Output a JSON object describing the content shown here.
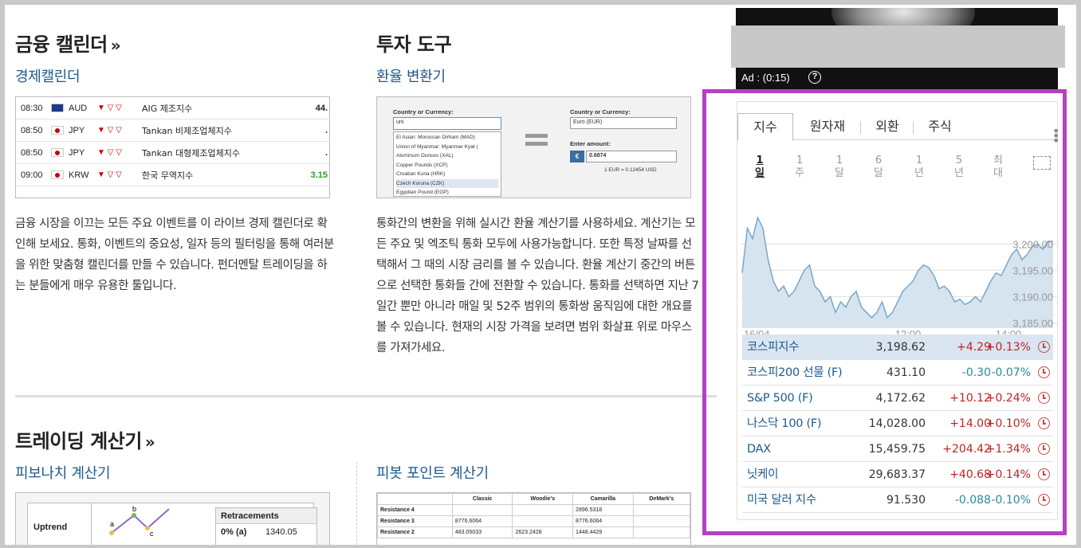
{
  "calendar": {
    "title": "금융 캘린더",
    "raquo": "»",
    "subtitle": "경제캘린더",
    "rows": [
      {
        "time": "08:30",
        "currency": "AUD",
        "event": "AIG 제조지수",
        "value": "44."
      },
      {
        "time": "08:50",
        "currency": "JPY",
        "event": "Tankan 비제조업체지수",
        "value": "."
      },
      {
        "time": "08:50",
        "currency": "JPY",
        "event": "Tankan 대형제조업체지수",
        "value": "."
      },
      {
        "time": "09:00",
        "currency": "KRW",
        "event": "한국 무역지수",
        "value": "3.15"
      }
    ],
    "description": "금융 시장을 이끄는 모든 주요 이벤트를 이 라이브 경제 캘린더로 확인해 보세요. 통화, 이벤트의 중요성, 일자 등의 필터링을 통해 여러분을 위한 맞춤형 캘린더를 만들 수 있습니다. 펀더멘탈 트레이딩을 하는 분들에게 매우 유용한 툴입니다."
  },
  "tools": {
    "title": "투자 도구",
    "subtitle": "환율 변환기",
    "converter": {
      "from_label": "Country or Currency:",
      "from_value": "uni",
      "options": [
        "El Asian: Moroccan Dirham (MAD)",
        "Union of Myanmar: Myanmar Kyat (",
        "Aluminum Ounces (XAL)",
        "Copper Pounds (XCP)",
        "Croatian Kuna (HRK)",
        "Czech Koruna (CZK)",
        "Egyptian Pound (EGP)"
      ],
      "to_label": "Country or Currency:",
      "to_value": "Euro (EUR)",
      "amount_label": "Enter amount:",
      "amount_value": "0.6874",
      "currency_symbol": "€",
      "rate": "1 EUR = 0.12454 USD"
    },
    "description": "통화간의 변환을 위해 실시간 환율 계산기를 사용하세요. 계산기는 모든 주요 및 엑조틱 통화 모두에 사용가능합니다. 또한 특정 날짜를 선택해서 그 때의 시장 금리를 볼 수 있습니다. 환율 계산기 중간의 버튼으로 선택한 통화들 간에 전환할 수 있습니다. 통화를 선택하면 지난 7일간 뿐만 아니라 매일 및 52주 범위의 통화쌍 움직임에 대한 개요를 볼 수 있습니다. 현재의 시장 가격을 보려면 범위 화살표 위로 마우스를 가져가세요."
  },
  "trading": {
    "title": "트레이딩 계산기",
    "fib_title": "피보나치 계산기",
    "pivot_title": "피봇 포인트 계산기",
    "fib": {
      "trend": "Uptrend",
      "retracements": "Retracements",
      "row_label": "0% (a)",
      "row_value": "1340.05",
      "points": [
        "a",
        "b",
        "c"
      ]
    },
    "pivot": {
      "headers": [
        "",
        "Classic",
        "Woodie's",
        "Camarilla",
        "DeMark's"
      ],
      "rows": [
        [
          "Resistance 4",
          "",
          "",
          "2896.5318",
          ""
        ],
        [
          "Resistance 3",
          "8776.6064",
          "",
          "8776.6064",
          ""
        ],
        [
          "Resistance 2",
          "483.05033",
          "2623.2428",
          "1448.4429",
          ""
        ]
      ]
    }
  },
  "ad": {
    "label": "Ad : (0:15)",
    "help": "?"
  },
  "widget": {
    "tabs": [
      "지수",
      "원자재",
      "외환",
      "주식"
    ],
    "active_tab": "지수",
    "ranges": [
      [
        "1",
        "일"
      ],
      [
        "1",
        "주"
      ],
      [
        "1",
        "달"
      ],
      [
        "6",
        "달"
      ],
      [
        "1",
        "년"
      ],
      [
        "5",
        "년"
      ],
      [
        "최",
        "대"
      ]
    ],
    "active_range": 0,
    "chart_data": {
      "type": "area",
      "x_ticks": [
        "16/04",
        "12:00",
        "14:00"
      ],
      "y_ticks": [
        "3,200.00",
        "3,195.00",
        "3,190.00",
        "3,185.00"
      ],
      "ylim": [
        3184,
        3207
      ],
      "values": [
        3194.5,
        3203,
        3201,
        3205,
        3203,
        3197,
        3193,
        3191,
        3192,
        3190,
        3191,
        3193,
        3195,
        3196,
        3192,
        3191,
        3189,
        3190,
        3187,
        3189,
        3188,
        3190,
        3191,
        3188,
        3187,
        3186,
        3187,
        3189,
        3186,
        3187,
        3189,
        3191,
        3192,
        3193,
        3195,
        3196,
        3195.5,
        3194,
        3191.5,
        3192,
        3191,
        3189,
        3189.5,
        3188.5,
        3189,
        3190,
        3189,
        3191,
        3193,
        3194.5,
        3194,
        3196,
        3198,
        3199,
        3197,
        3198,
        3199.5,
        3200,
        3199,
        3200.5,
        3200.5
      ],
      "fill": "#d6e4f0",
      "line": "#7aa6c8"
    },
    "quotes": [
      {
        "name": "코스피지수",
        "price": "3,198.62",
        "change": "+4.29",
        "pct": "+0.13%",
        "dir": "up"
      },
      {
        "name": "코스피200 선물 (F)",
        "price": "431.10",
        "change": "-0.30",
        "pct": "-0.07%",
        "dir": "dn"
      },
      {
        "name": "S&P 500 (F)",
        "price": "4,172.62",
        "change": "+10.12",
        "pct": "+0.24%",
        "dir": "up"
      },
      {
        "name": "나스닥 100 (F)",
        "price": "14,028.00",
        "change": "+14.00",
        "pct": "+0.10%",
        "dir": "up"
      },
      {
        "name": "DAX",
        "price": "15,459.75",
        "change": "+204.42",
        "pct": "+1.34%",
        "dir": "up"
      },
      {
        "name": "닛케이",
        "price": "29,683.37",
        "change": "+40.68",
        "pct": "+0.14%",
        "dir": "up"
      },
      {
        "name": "미국 달러 지수",
        "price": "91.530",
        "change": "-0.088",
        "pct": "-0.10%",
        "dir": "dn"
      }
    ],
    "colors": {
      "up": "#c02323",
      "down": "#2b8a9a",
      "highlight": "#b342c0"
    }
  }
}
